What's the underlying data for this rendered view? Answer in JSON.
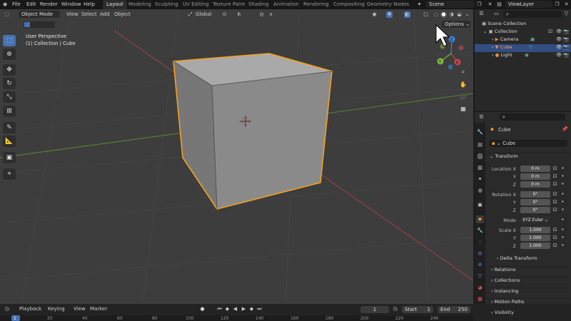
{
  "top_menu": {
    "items": [
      "File",
      "Edit",
      "Render",
      "Window",
      "Help"
    ],
    "workspaces": [
      "Layout",
      "Modeling",
      "Sculpting",
      "UV Editing",
      "Texture Paint",
      "Shading",
      "Animation",
      "Rendering",
      "Compositing",
      "Geometry Nodes"
    ],
    "active_workspace": "Layout",
    "scene_name": "Scene",
    "view_layer": "ViewLayer"
  },
  "viewport_header": {
    "mode": "Object Mode",
    "menus": [
      "View",
      "Select",
      "Add",
      "Object"
    ],
    "transform_orientation": "Global",
    "options_label": "Options"
  },
  "viewport": {
    "perspective": "User Perspective",
    "collection_info": "(1) Collection | Cube",
    "gizmo_axes": [
      "X",
      "Y",
      "Z"
    ]
  },
  "outliner": {
    "scene_collection": "Scene Collection",
    "collection": "Collection",
    "objects": [
      "Camera",
      "Cube",
      "Light"
    ],
    "selected": "Cube"
  },
  "properties": {
    "object_name": "Cube",
    "object_datablock": "Cube",
    "transform_label": "Transform",
    "location_label": "Location X",
    "location": [
      "0 m",
      "0 m",
      "0 m"
    ],
    "rotation_label": "Rotation X",
    "rotation": [
      "0°",
      "0°",
      "0°"
    ],
    "mode_label": "Mode",
    "rotation_mode": "XYZ Euler",
    "scale_label": "Scale X",
    "scale": [
      "1.000",
      "1.000",
      "1.000"
    ],
    "axis_y": "Y",
    "axis_z": "Z",
    "panels": [
      "Delta Transform",
      "Relations",
      "Collections",
      "Instancing",
      "Motion Paths",
      "Visibility"
    ]
  },
  "timeline": {
    "menus": [
      "Playback",
      "Keying",
      "View",
      "Marker"
    ],
    "current_frame": "1",
    "start_label": "Start",
    "start": "1",
    "end_label": "End",
    "end": "250",
    "ruler_ticks": [
      "1",
      "20",
      "40",
      "60",
      "80",
      "100",
      "120",
      "140",
      "160",
      "180",
      "200",
      "220",
      "240"
    ]
  },
  "colors": {
    "selection_outline": "#f5a020",
    "active_highlight": "#4772b3",
    "x_axis": "#c8474f",
    "y_axis": "#7fb83c",
    "z_axis": "#3b82d8"
  }
}
